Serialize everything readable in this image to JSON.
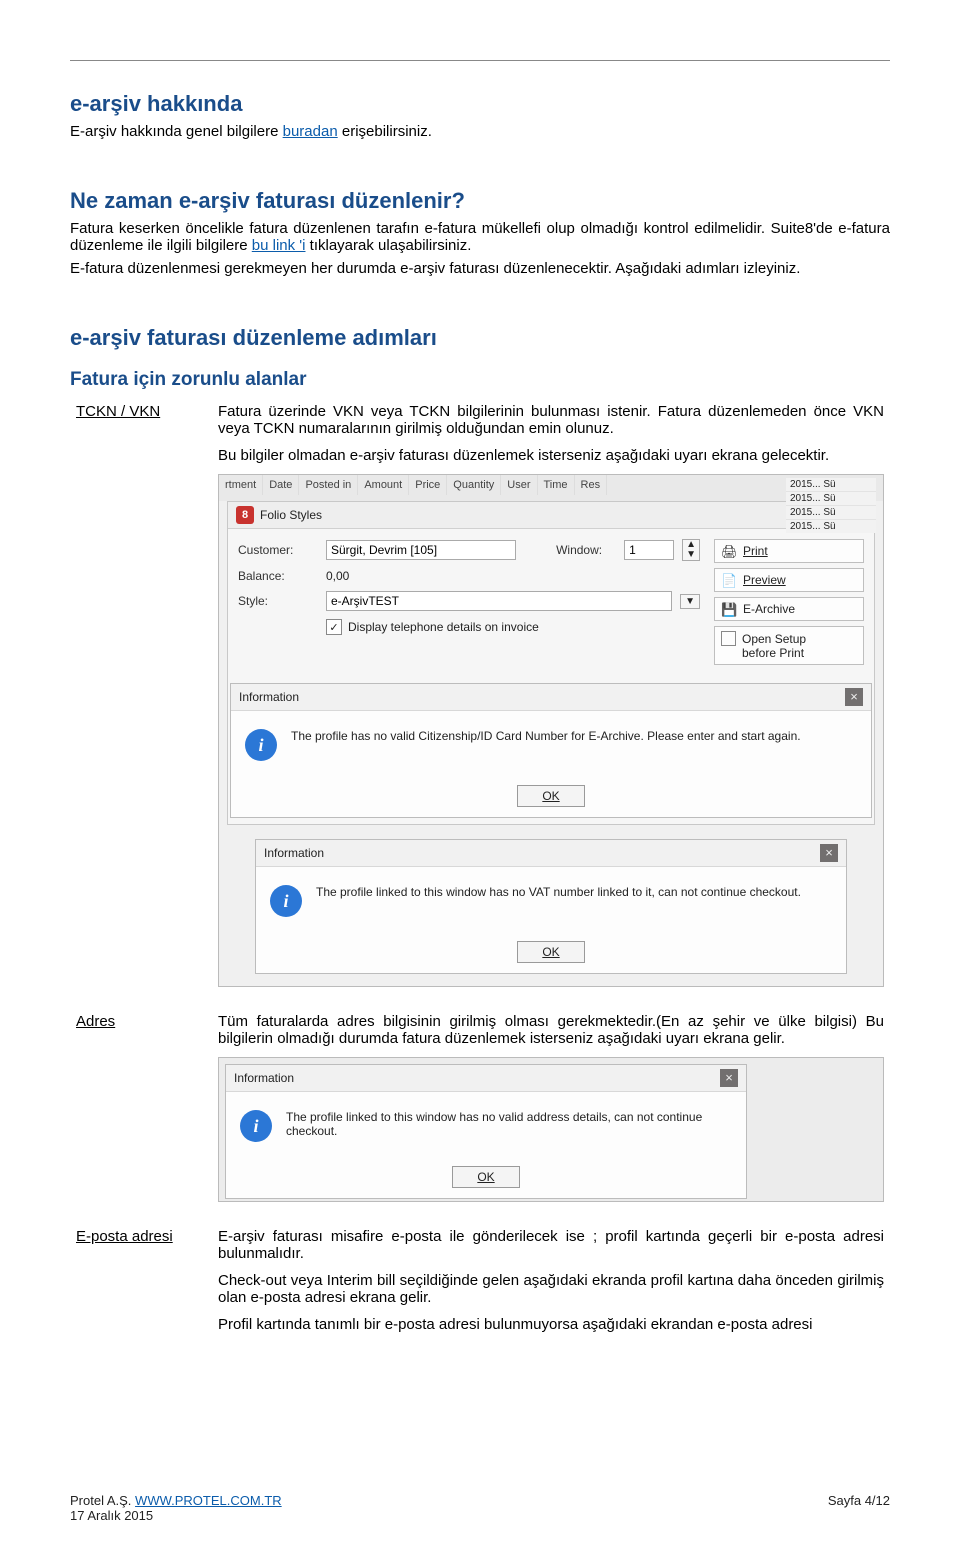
{
  "h_about": "e-arşiv hakkında",
  "p_about_a": "E-arşiv hakkında genel bilgilere ",
  "p_about_link": "buradan",
  "p_about_b": " erişebilirsiniz.",
  "h_when": "Ne zaman e-arşiv faturası düzenlenir?",
  "p_when_a": "Fatura keserken öncelikle fatura düzenlenen tarafın e-fatura mükellefi olup olmadığı kontrol edilmelidir. Suite8'de e-fatura düzenleme ile ilgili bilgilere ",
  "p_when_link": "bu link 'i",
  "p_when_b": " tıklayarak ulaşabilirsiniz.",
  "p_when_c": "E-fatura düzenlenmesi gerekmeyen her durumda e-arşiv faturası düzenlenecektir. Aşağıdaki adımları izleyiniz.",
  "h_steps": "e-arşiv faturası düzenleme adımları",
  "h_required": "Fatura için zorunlu alanlar",
  "row1_label": "TCKN / VKN",
  "row1_p1": "Fatura üzerinde VKN veya TCKN bilgilerinin bulunması istenir. Fatura düzenlemeden önce VKN veya TCKN numaralarının girilmiş olduğundan emin olunuz.",
  "row1_p2": "Bu bilgiler olmadan e-arşiv faturası düzenlemek isterseniz aşağıdaki uyarı ekrana gelecektir.",
  "grid_cols": [
    "rtment",
    "Date",
    "Posted in",
    "Amount",
    "Price",
    "Quantity",
    "User",
    "Time",
    "Res"
  ],
  "grid_right_rows": [
    "2015...   Sü",
    "2015...   Sü",
    "2015...   Sü",
    "2015...   Sü"
  ],
  "folio_title": "Folio Styles",
  "badge": "8",
  "lbl_customer": "Customer:",
  "val_customer": "Sürgit, Devrim [105]",
  "lbl_window": "Window:",
  "val_window": "1",
  "lbl_balance": "Balance:",
  "val_balance": "0,00",
  "lbl_style": "Style:",
  "val_style": "e-ArşivTEST",
  "chk_label": "Display telephone details on invoice",
  "btn_print": "Print",
  "btn_preview": "Preview",
  "btn_earchive": "E-Archive",
  "btn_opensetup_l1": "Open Setup",
  "btn_opensetup_l2": "before Print",
  "info_title": "Information",
  "info_msg1": "The profile has no valid Citizenship/ID Card Number for E-Archive. Please enter and start again.",
  "info_msg2": "The profile linked to this window has no VAT number linked to it, can not continue checkout.",
  "info_msg3": "The profile linked to this window has no valid address details, can not continue checkout.",
  "ok": "OK",
  "row2_label": "Adres",
  "row2_p1": "Tüm faturalarda adres bilgisinin girilmiş olması gerekmektedir.(En az şehir ve ülke bilgisi) Bu bilgilerin olmadığı durumda fatura düzenlemek isterseniz aşağıdaki uyarı ekrana gelir.",
  "row3_label": "E-posta adresi",
  "row3_p1": "E-arşiv faturası misafire e-posta ile gönderilecek ise ; profil kartında geçerli bir e-posta adresi bulunmalıdır.",
  "row3_p2": "Check-out veya Interim bill seçildiğinde gelen aşağıdaki ekranda profil kartına daha önceden girilmiş olan e-posta adresi ekrana gelir.",
  "row3_p3": "Profil kartında tanımlı bir e-posta adresi bulunmuyorsa aşağıdaki ekrandan e-posta adresi",
  "footer_left_a": "Protel A.Ş. ",
  "footer_left_link": "WWW.PROTEL.COM.TR",
  "footer_left_b": "17 Aralık 2015",
  "footer_right": "Sayfa 4/12"
}
